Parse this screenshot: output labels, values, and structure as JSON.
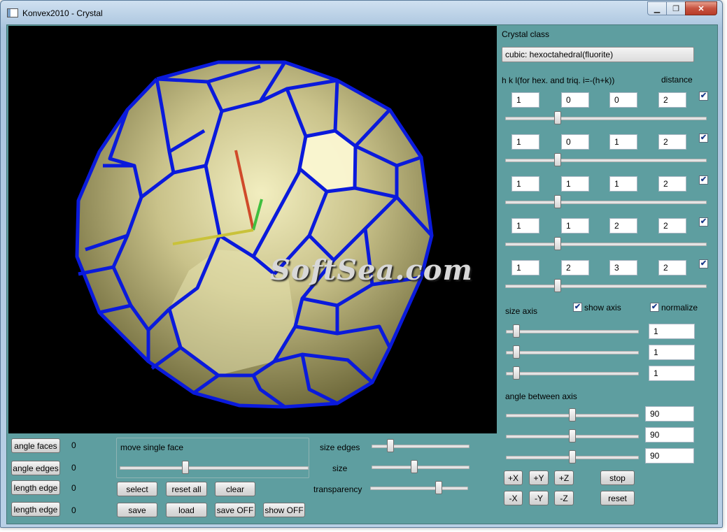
{
  "window": {
    "title": "Konvex2010 - Crystal",
    "controls": [
      "minimize-icon",
      "maximize-icon",
      "close-icon"
    ]
  },
  "viewport": {
    "watermark": "SoftSea.com",
    "edge_color": "#0a1adc",
    "face_color": "#bdb47a",
    "background": "#000000"
  },
  "panel": {
    "crystal_class_label": "Crystal class",
    "crystal_class_value": "cubic: hexoctahedral(fluorite)",
    "hkl_label": "h k l(for hex. and triq. i=-(h+k))",
    "distance_label": "distance",
    "faces": [
      {
        "h": "1",
        "k": "0",
        "l": "0",
        "distance": "2",
        "checked": true,
        "slider": 0.25
      },
      {
        "h": "1",
        "k": "0",
        "l": "1",
        "distance": "2",
        "checked": true,
        "slider": 0.25
      },
      {
        "h": "1",
        "k": "1",
        "l": "1",
        "distance": "2",
        "checked": true,
        "slider": 0.25
      },
      {
        "h": "1",
        "k": "1",
        "l": "2",
        "distance": "2",
        "checked": true,
        "slider": 0.25
      },
      {
        "h": "1",
        "k": "2",
        "l": "3",
        "distance": "2",
        "checked": true,
        "slider": 0.25
      }
    ],
    "size_axis_label": "size axis",
    "show_axis_label": "show axis",
    "normalize_label": "normalize",
    "size_axis_values": [
      "1",
      "1",
      "1"
    ],
    "angle_axis_label": "angle between axis",
    "angle_values": [
      "90",
      "90",
      "90"
    ],
    "axis_buttons_top": [
      "+X",
      "+Y",
      "+Z"
    ],
    "axis_buttons_bottom": [
      "-X",
      "-Y",
      "-Z"
    ],
    "stop_label": "stop",
    "reset_label": "reset"
  },
  "bottom": {
    "angle_faces_label": "angle faces",
    "angle_faces_value": "0",
    "angle_edges_label": "angle edges",
    "angle_edges_value": "0",
    "length_edge_label_1": "length edge",
    "length_edge_value_1": "0",
    "length_edge_label_2": "length edge",
    "length_edge_value_2": "0",
    "move_single_face_label": "move single face",
    "select_label": "select",
    "reset_all_label": "reset all",
    "clear_label": "clear",
    "save_label": "save",
    "load_label": "load",
    "save_off_label": "save OFF",
    "show_off_label": "show OFF",
    "size_edges_label": "size edges",
    "size_label": "size",
    "transparency_label": "transparency"
  }
}
